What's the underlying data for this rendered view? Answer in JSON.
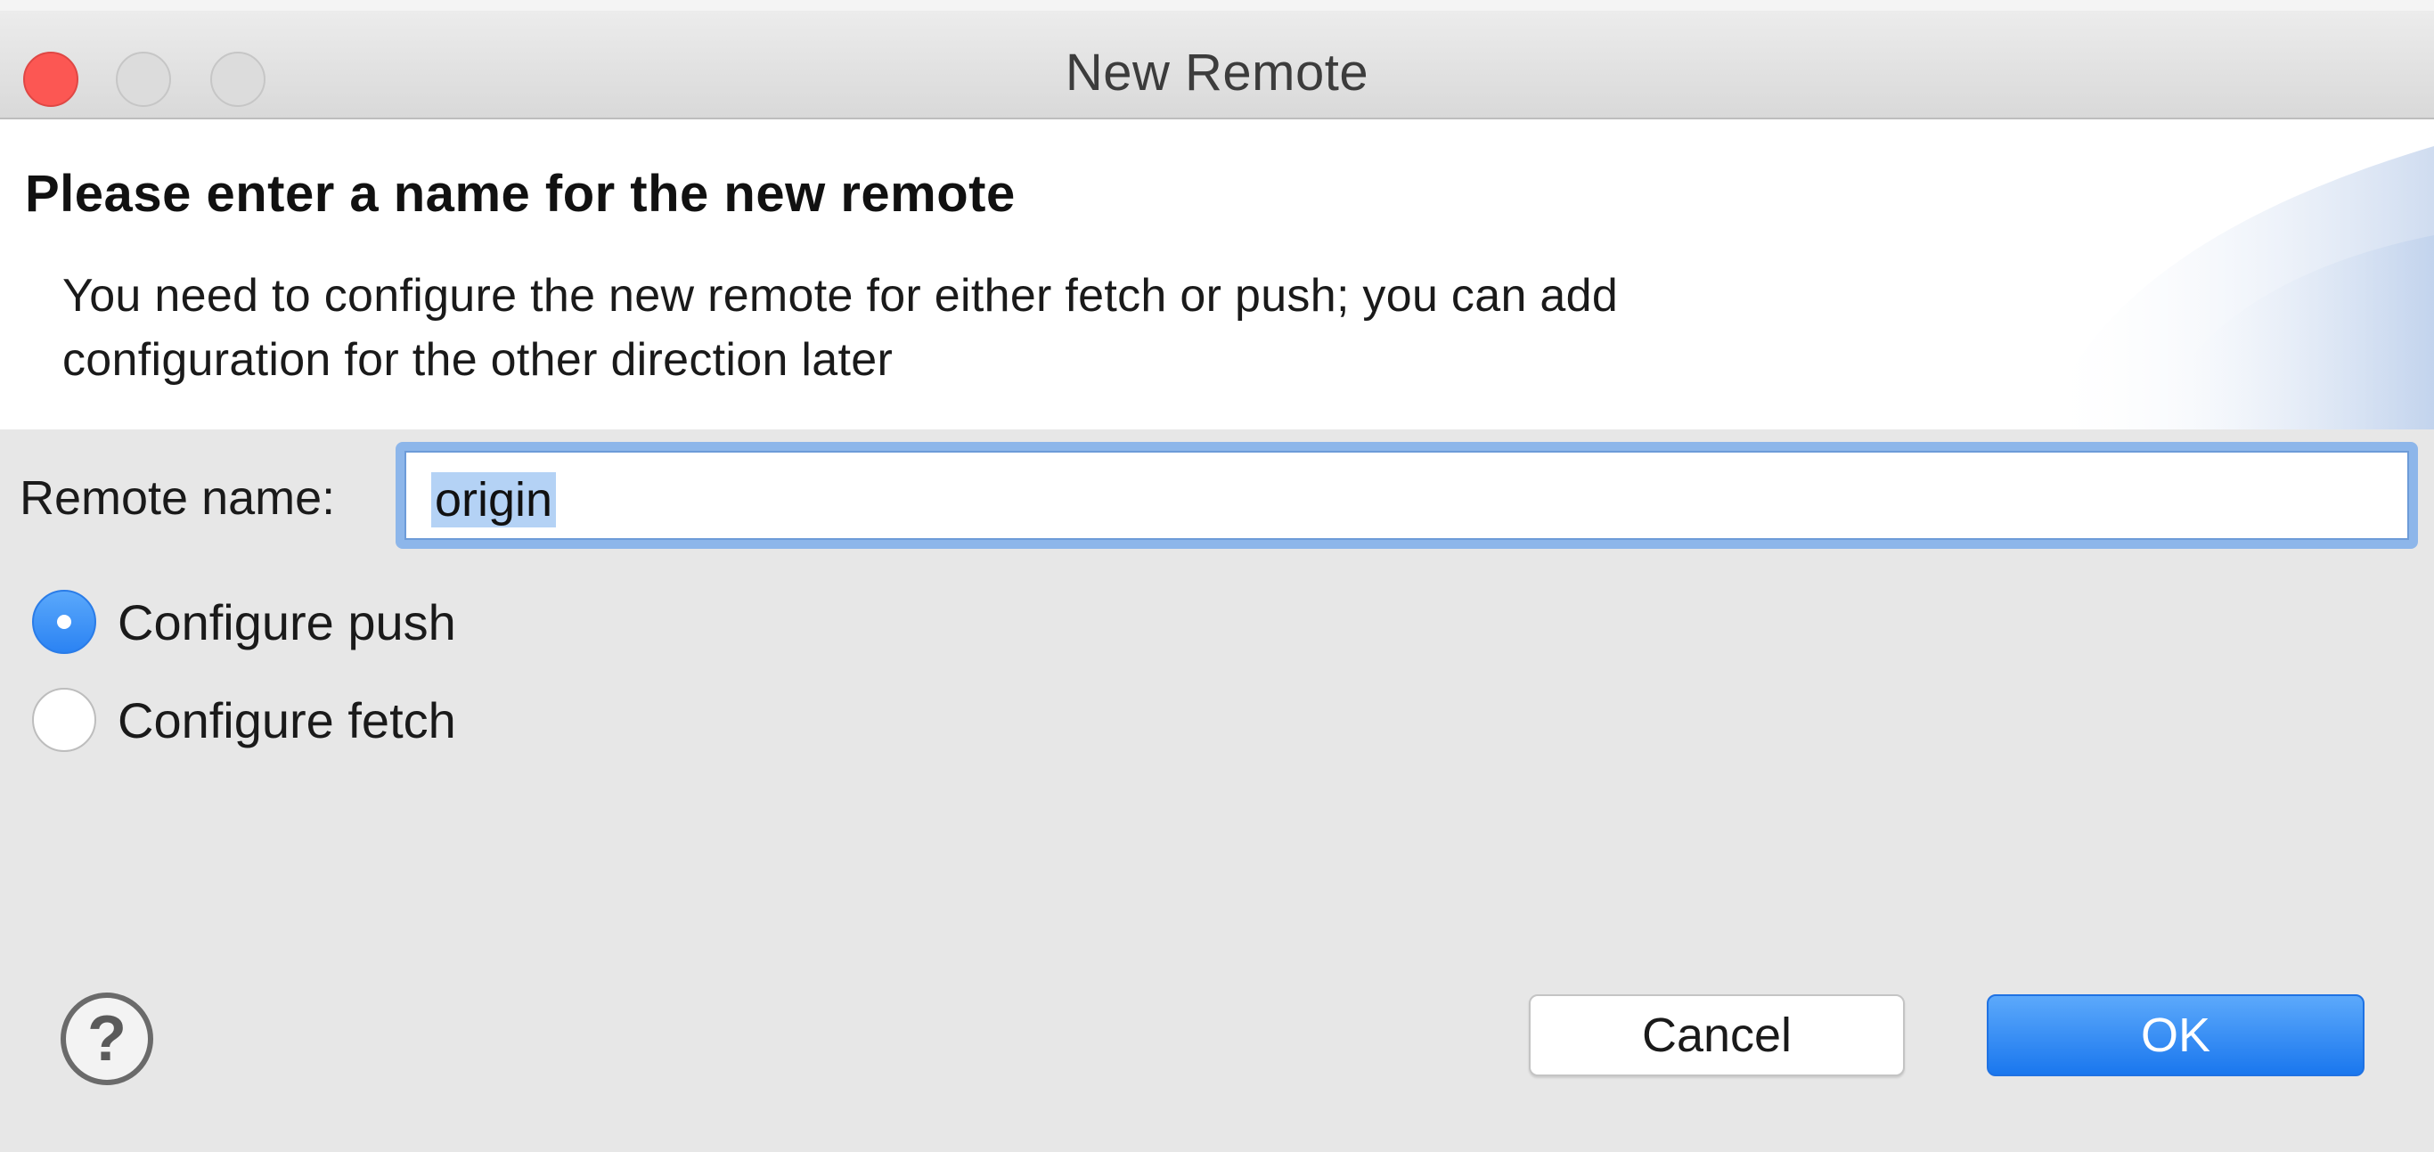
{
  "window": {
    "title": "New Remote"
  },
  "banner": {
    "heading": "Please enter a name for the new remote",
    "description_line1": "You need to configure the new remote for either fetch or push; you can add",
    "description_line2": "configuration for the other direction later"
  },
  "form": {
    "remote_name_label": "Remote name:",
    "remote_name_value": "origin",
    "options": [
      {
        "label": "Configure push",
        "selected": true
      },
      {
        "label": "Configure fetch",
        "selected": false
      }
    ]
  },
  "footer": {
    "help_symbol": "?",
    "cancel_label": "Cancel",
    "ok_label": "OK"
  },
  "colors": {
    "close_button": "#fc5753",
    "accent_blue": "#2b83f3",
    "focus_ring": "#8db6ea",
    "selection": "#b4d2f5"
  },
  "icons": [
    "close-traffic-light",
    "minimize-traffic-light",
    "maximize-traffic-light",
    "help-icon",
    "radio-selected",
    "radio-unselected"
  ]
}
